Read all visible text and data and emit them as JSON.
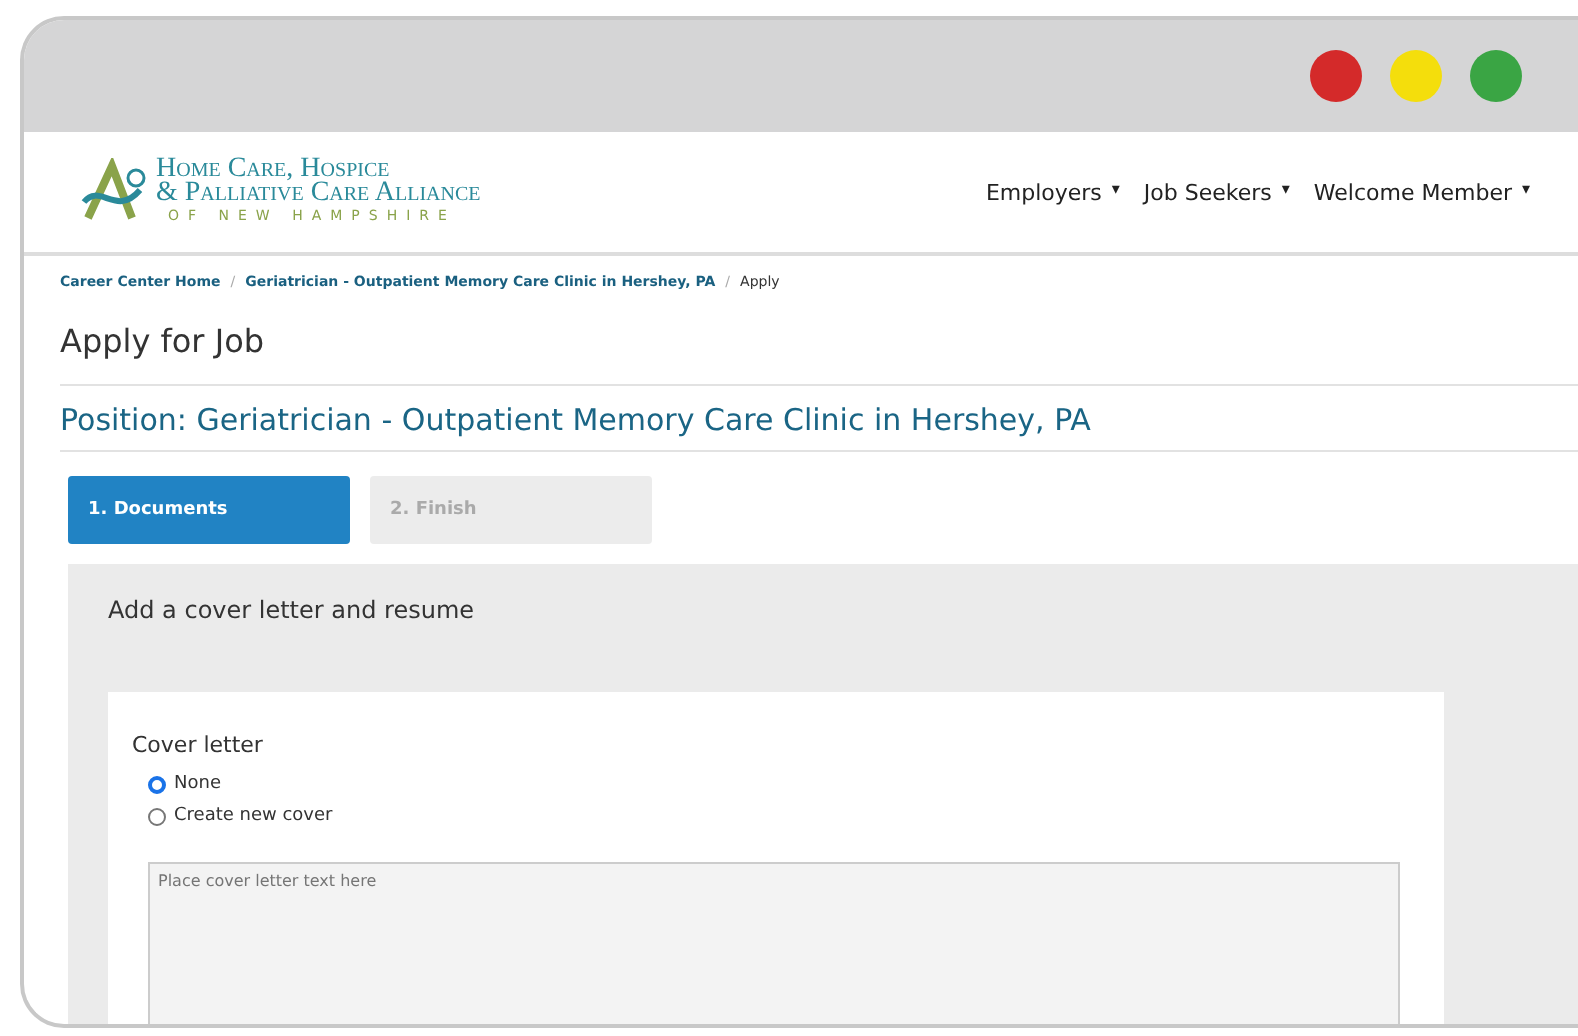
{
  "logo": {
    "line_1": "Home Care, Hospice",
    "line_2": "& Palliative Care Alliance",
    "line_3": "OF NEW HAMPSHIRE"
  },
  "nav": [
    {
      "label": "Employers",
      "caret": "▾"
    },
    {
      "label": "Job Seekers",
      "caret": "▾"
    },
    {
      "label": "Welcome Member",
      "caret": "▾"
    }
  ],
  "breadcrumb": [
    {
      "label": "Career Center Home",
      "kind": "link"
    },
    {
      "separator": "/",
      "label": "Geriatrician - Outpatient Memory Care Clinic in Hershey, PA",
      "kind": "link"
    },
    {
      "separator": "/",
      "label": "Apply",
      "kind": "current"
    }
  ],
  "page_title": "Apply for Job",
  "position_title": "Position: Geriatrician - Outpatient Memory Care Clinic in Hershey, PA",
  "steps": [
    {
      "label": "1. Documents",
      "selected": true
    },
    {
      "label": "2. Finish",
      "selected": false
    }
  ],
  "panel": {
    "title": "Add a cover letter and resume",
    "cover_letter": {
      "label": "Cover letter",
      "options": [
        {
          "label": "None",
          "selected": true
        },
        {
          "label": "Create new cover",
          "selected": false
        }
      ],
      "placeholder": "Place cover letter text here"
    }
  }
}
